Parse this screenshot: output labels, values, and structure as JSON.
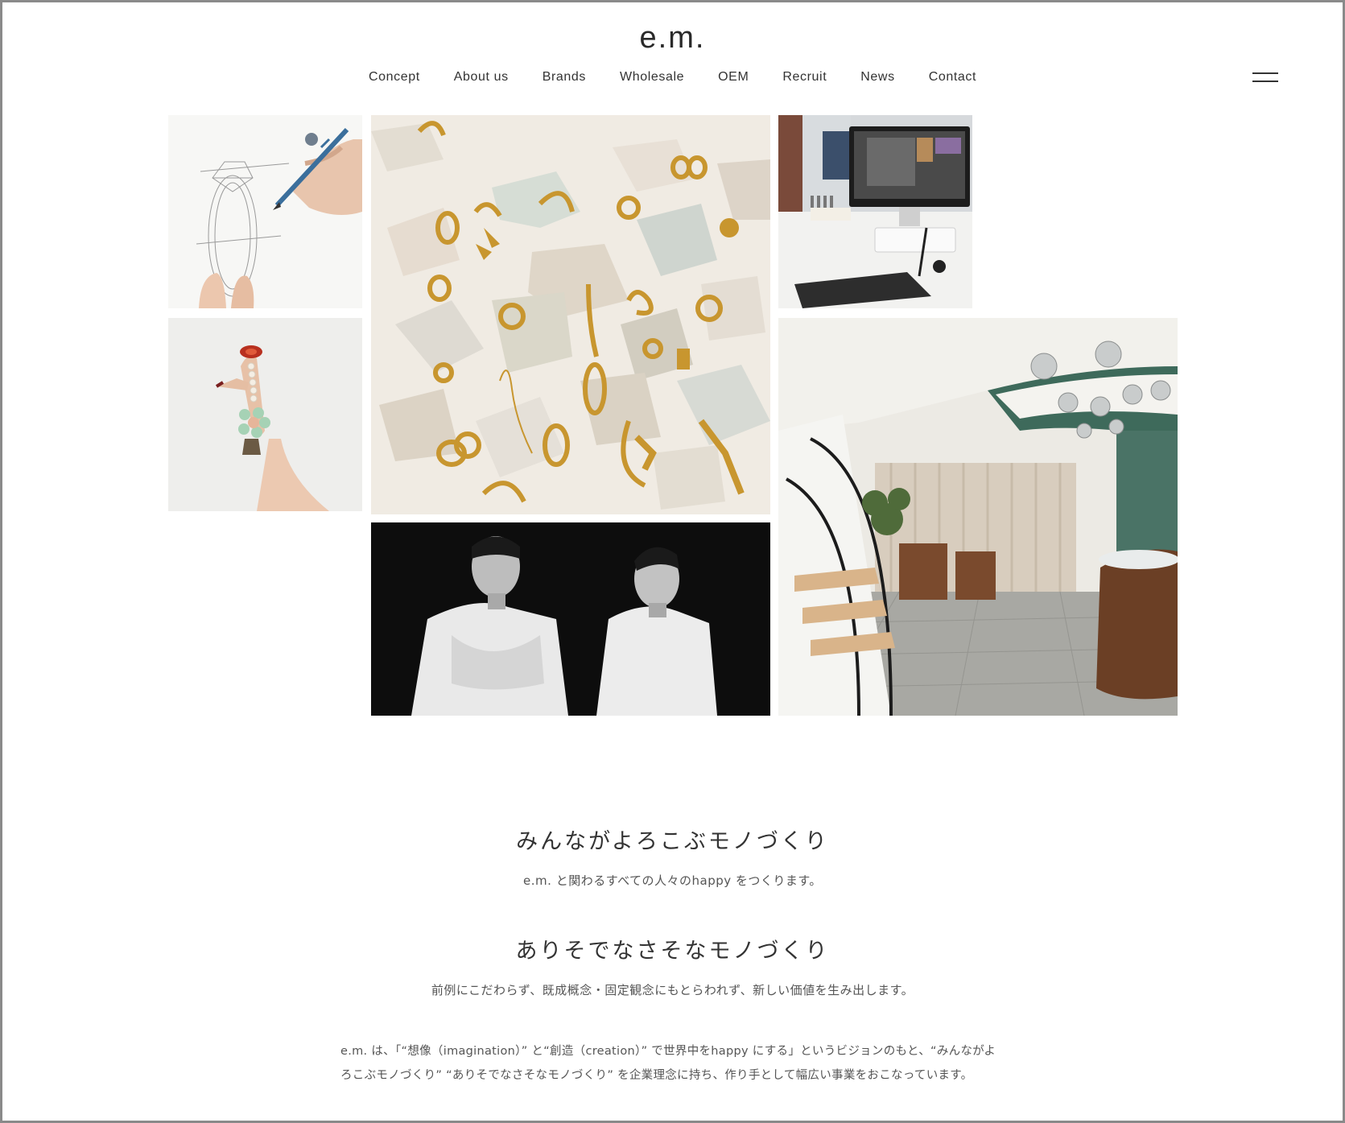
{
  "header": {
    "logo": "e.m.",
    "nav": [
      {
        "label": "Concept"
      },
      {
        "label": "About us"
      },
      {
        "label": "Brands"
      },
      {
        "label": "Wholesale"
      },
      {
        "label": "OEM"
      },
      {
        "label": "Recruit"
      },
      {
        "label": "News"
      },
      {
        "label": "Contact"
      }
    ],
    "menu_icon": "hamburger-menu-icon"
  },
  "gallery": {
    "images": [
      {
        "name": "ring-sketch-photo"
      },
      {
        "name": "hand-jewelry-photo"
      },
      {
        "name": "gold-jewelry-on-stones-photo"
      },
      {
        "name": "design-desk-photo"
      },
      {
        "name": "founders-portrait-photo"
      },
      {
        "name": "shop-interior-photo"
      }
    ]
  },
  "concept": {
    "heading1": "みんながよろこぶモノづくり",
    "sub1": "e.m. と関わるすべての人々のhappy をつくります。",
    "heading2": "ありそでなさそなモノづくり",
    "sub2": "前例にこだわらず、既成概念・固定観念にもとらわれず、新しい価値を生み出します。",
    "body_line1": "e.m. は、「“想像（imagination）” と“創造（creation）” で世界中をhappy にする」というビジョンのもと、“みんながよ",
    "body_line2": "ろこぶモノづくり” “ありそでなさそなモノづくり” を企業理念に持ち、作り手として幅広い事業をおこなっています。"
  }
}
